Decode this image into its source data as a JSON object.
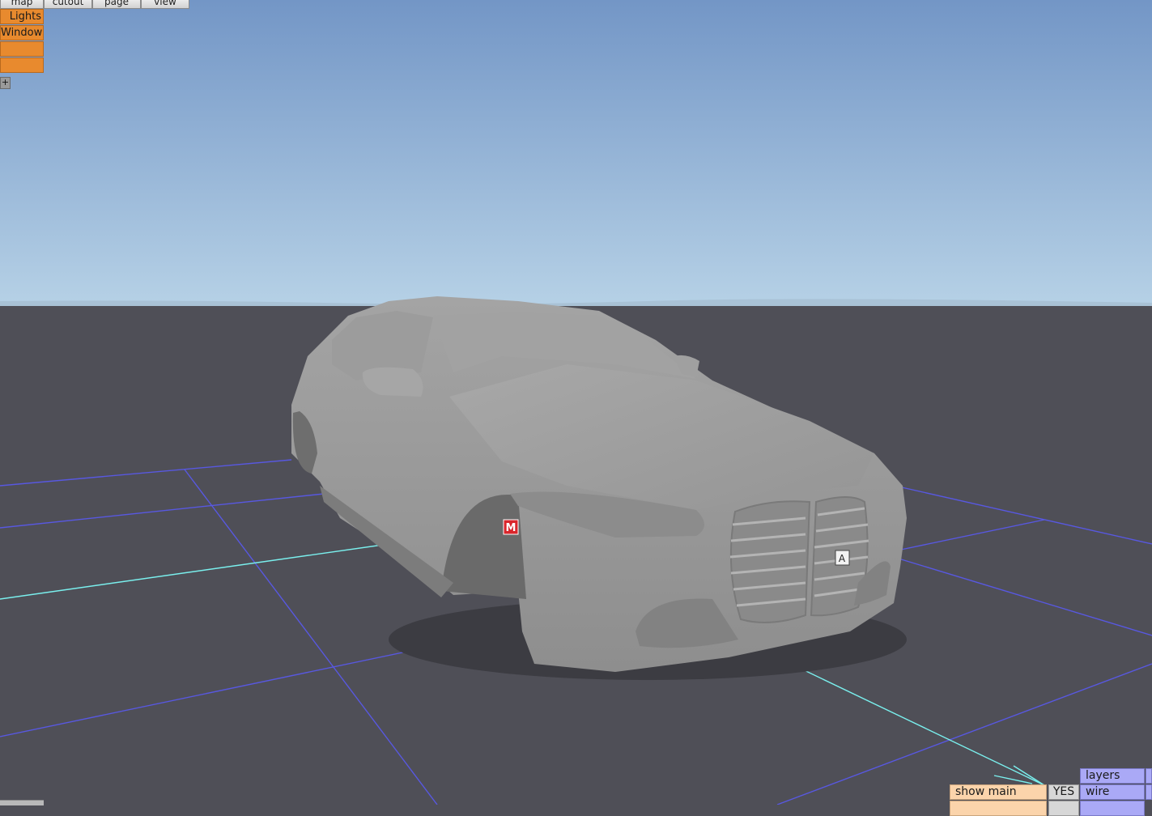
{
  "menu": [
    {
      "label": "map"
    },
    {
      "label": "cutout"
    },
    {
      "label": "page"
    },
    {
      "label": "view"
    }
  ],
  "side_panel": {
    "items": [
      {
        "label": "Lights"
      },
      {
        "label": "Windows"
      },
      {
        "label": ""
      },
      {
        "label": ""
      }
    ],
    "add_label": "+"
  },
  "viewport": {
    "markers": {
      "m": "M",
      "a": "A"
    },
    "colors": {
      "sky_top": "#7a9ccb",
      "sky_bottom": "#b9d2e6",
      "ground": "#4f4f57",
      "grid": "#5a5ae6",
      "axis": "#6ee8e8",
      "car": "#9a9a9a"
    }
  },
  "props": {
    "show_main": "show main",
    "show_main_value": "YES",
    "layers": "layers",
    "wire": "wire"
  }
}
